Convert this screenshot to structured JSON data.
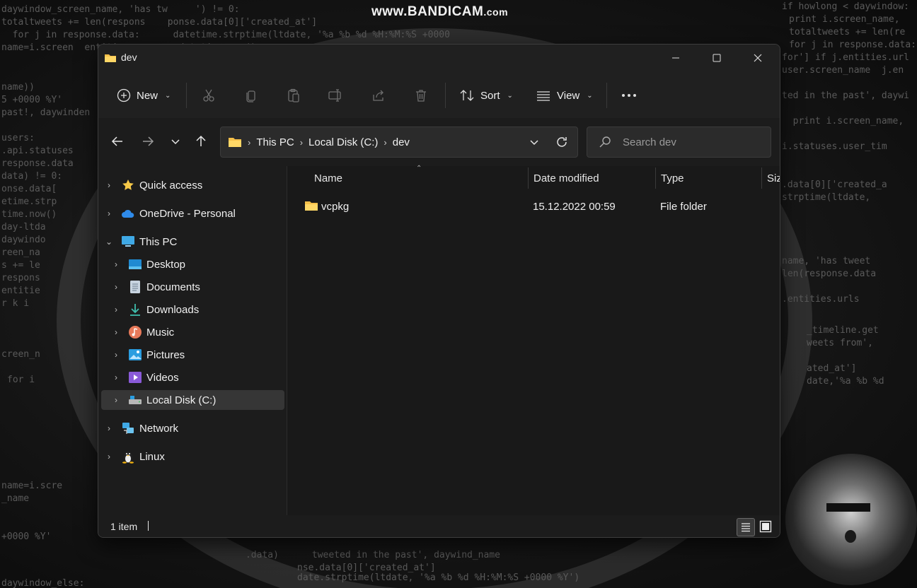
{
  "watermark": {
    "main": "www.BANDICAM",
    "suffix": ".com"
  },
  "window": {
    "title": "dev",
    "controls": [
      "minimize-icon",
      "maximize-icon",
      "close-icon"
    ]
  },
  "commandbar": {
    "new_label": "New",
    "sort_label": "Sort",
    "view_label": "View",
    "tools": [
      "cut-icon",
      "copy-icon",
      "paste-icon",
      "rename-icon",
      "share-icon",
      "delete-icon"
    ],
    "more_icon": "more-icon"
  },
  "address": {
    "crumbs": [
      "This PC",
      "Local Disk (C:)",
      "dev"
    ],
    "search_placeholder": "Search dev"
  },
  "navpane": {
    "items": [
      {
        "label": "Quick access",
        "icon": "star-icon"
      },
      {
        "label": "OneDrive - Personal",
        "icon": "cloud-icon"
      },
      {
        "label": "This PC",
        "icon": "computer-icon"
      },
      {
        "label": "Desktop",
        "icon": "desktop-icon"
      },
      {
        "label": "Documents",
        "icon": "documents-icon"
      },
      {
        "label": "Downloads",
        "icon": "download-icon"
      },
      {
        "label": "Music",
        "icon": "music-icon"
      },
      {
        "label": "Pictures",
        "icon": "pictures-icon"
      },
      {
        "label": "Videos",
        "icon": "videos-icon"
      },
      {
        "label": "Local Disk (C:)",
        "icon": "drive-icon",
        "selected": true
      },
      {
        "label": "Network",
        "icon": "network-icon"
      },
      {
        "label": "Linux",
        "icon": "linux-icon"
      }
    ]
  },
  "filelist": {
    "columns": [
      "Name",
      "Date modified",
      "Type",
      "Siz"
    ],
    "rows": [
      {
        "name": "vcpkg",
        "date": "15.12.2022 00:59",
        "type": "File folder",
        "icon": "folder-icon"
      }
    ]
  },
  "status": {
    "count": "1 item"
  },
  "colors": {
    "folder": "#f5c04a",
    "window_bg": "#191919",
    "accent": "#4cc2ff"
  }
}
